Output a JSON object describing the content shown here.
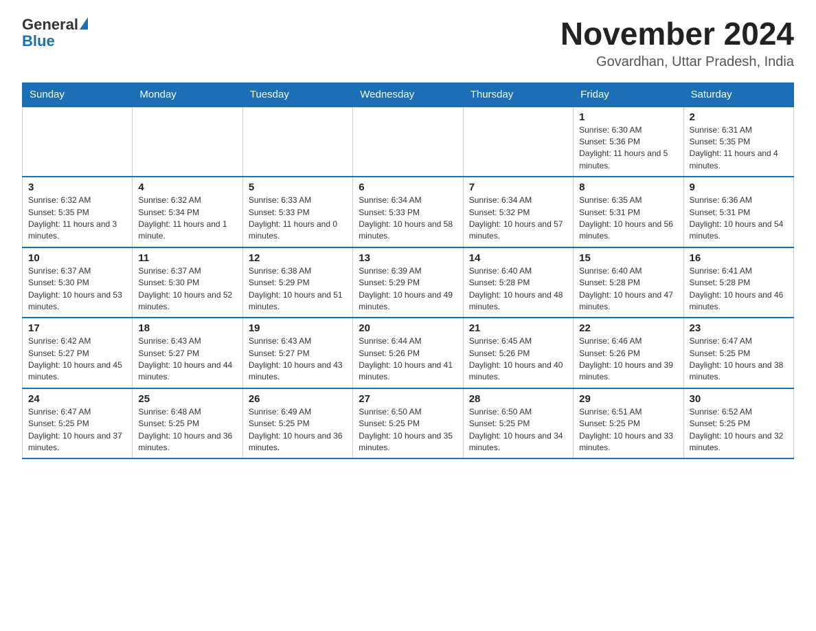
{
  "header": {
    "logo_general": "General",
    "logo_blue": "Blue",
    "month_title": "November 2024",
    "location": "Govardhan, Uttar Pradesh, India"
  },
  "weekdays": [
    "Sunday",
    "Monday",
    "Tuesday",
    "Wednesday",
    "Thursday",
    "Friday",
    "Saturday"
  ],
  "weeks": [
    [
      {
        "day": "",
        "info": ""
      },
      {
        "day": "",
        "info": ""
      },
      {
        "day": "",
        "info": ""
      },
      {
        "day": "",
        "info": ""
      },
      {
        "day": "",
        "info": ""
      },
      {
        "day": "1",
        "info": "Sunrise: 6:30 AM\nSunset: 5:36 PM\nDaylight: 11 hours and 5 minutes."
      },
      {
        "day": "2",
        "info": "Sunrise: 6:31 AM\nSunset: 5:35 PM\nDaylight: 11 hours and 4 minutes."
      }
    ],
    [
      {
        "day": "3",
        "info": "Sunrise: 6:32 AM\nSunset: 5:35 PM\nDaylight: 11 hours and 3 minutes."
      },
      {
        "day": "4",
        "info": "Sunrise: 6:32 AM\nSunset: 5:34 PM\nDaylight: 11 hours and 1 minute."
      },
      {
        "day": "5",
        "info": "Sunrise: 6:33 AM\nSunset: 5:33 PM\nDaylight: 11 hours and 0 minutes."
      },
      {
        "day": "6",
        "info": "Sunrise: 6:34 AM\nSunset: 5:33 PM\nDaylight: 10 hours and 58 minutes."
      },
      {
        "day": "7",
        "info": "Sunrise: 6:34 AM\nSunset: 5:32 PM\nDaylight: 10 hours and 57 minutes."
      },
      {
        "day": "8",
        "info": "Sunrise: 6:35 AM\nSunset: 5:31 PM\nDaylight: 10 hours and 56 minutes."
      },
      {
        "day": "9",
        "info": "Sunrise: 6:36 AM\nSunset: 5:31 PM\nDaylight: 10 hours and 54 minutes."
      }
    ],
    [
      {
        "day": "10",
        "info": "Sunrise: 6:37 AM\nSunset: 5:30 PM\nDaylight: 10 hours and 53 minutes."
      },
      {
        "day": "11",
        "info": "Sunrise: 6:37 AM\nSunset: 5:30 PM\nDaylight: 10 hours and 52 minutes."
      },
      {
        "day": "12",
        "info": "Sunrise: 6:38 AM\nSunset: 5:29 PM\nDaylight: 10 hours and 51 minutes."
      },
      {
        "day": "13",
        "info": "Sunrise: 6:39 AM\nSunset: 5:29 PM\nDaylight: 10 hours and 49 minutes."
      },
      {
        "day": "14",
        "info": "Sunrise: 6:40 AM\nSunset: 5:28 PM\nDaylight: 10 hours and 48 minutes."
      },
      {
        "day": "15",
        "info": "Sunrise: 6:40 AM\nSunset: 5:28 PM\nDaylight: 10 hours and 47 minutes."
      },
      {
        "day": "16",
        "info": "Sunrise: 6:41 AM\nSunset: 5:28 PM\nDaylight: 10 hours and 46 minutes."
      }
    ],
    [
      {
        "day": "17",
        "info": "Sunrise: 6:42 AM\nSunset: 5:27 PM\nDaylight: 10 hours and 45 minutes."
      },
      {
        "day": "18",
        "info": "Sunrise: 6:43 AM\nSunset: 5:27 PM\nDaylight: 10 hours and 44 minutes."
      },
      {
        "day": "19",
        "info": "Sunrise: 6:43 AM\nSunset: 5:27 PM\nDaylight: 10 hours and 43 minutes."
      },
      {
        "day": "20",
        "info": "Sunrise: 6:44 AM\nSunset: 5:26 PM\nDaylight: 10 hours and 41 minutes."
      },
      {
        "day": "21",
        "info": "Sunrise: 6:45 AM\nSunset: 5:26 PM\nDaylight: 10 hours and 40 minutes."
      },
      {
        "day": "22",
        "info": "Sunrise: 6:46 AM\nSunset: 5:26 PM\nDaylight: 10 hours and 39 minutes."
      },
      {
        "day": "23",
        "info": "Sunrise: 6:47 AM\nSunset: 5:25 PM\nDaylight: 10 hours and 38 minutes."
      }
    ],
    [
      {
        "day": "24",
        "info": "Sunrise: 6:47 AM\nSunset: 5:25 PM\nDaylight: 10 hours and 37 minutes."
      },
      {
        "day": "25",
        "info": "Sunrise: 6:48 AM\nSunset: 5:25 PM\nDaylight: 10 hours and 36 minutes."
      },
      {
        "day": "26",
        "info": "Sunrise: 6:49 AM\nSunset: 5:25 PM\nDaylight: 10 hours and 36 minutes."
      },
      {
        "day": "27",
        "info": "Sunrise: 6:50 AM\nSunset: 5:25 PM\nDaylight: 10 hours and 35 minutes."
      },
      {
        "day": "28",
        "info": "Sunrise: 6:50 AM\nSunset: 5:25 PM\nDaylight: 10 hours and 34 minutes."
      },
      {
        "day": "29",
        "info": "Sunrise: 6:51 AM\nSunset: 5:25 PM\nDaylight: 10 hours and 33 minutes."
      },
      {
        "day": "30",
        "info": "Sunrise: 6:52 AM\nSunset: 5:25 PM\nDaylight: 10 hours and 32 minutes."
      }
    ]
  ]
}
